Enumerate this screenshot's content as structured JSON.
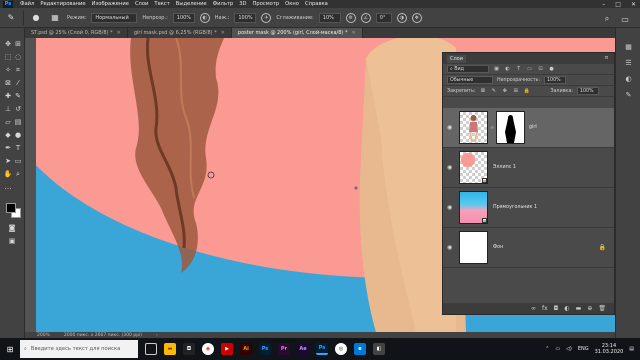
{
  "menubar": {
    "items": [
      "Файл",
      "Редактирование",
      "Изображение",
      "Слои",
      "Текст",
      "Выделение",
      "Фильтр",
      "3D",
      "Просмотр",
      "Окно",
      "Справка"
    ]
  },
  "options": {
    "mode_label": "Режим:",
    "mode_value": "Нормальный",
    "opacity_label": "Непрозр.:",
    "opacity_value": "100%",
    "pressure_label": "Наж.:",
    "pressure_value": "100%",
    "smoothing_label": "Сглаживание:",
    "smoothing_value": "10%",
    "angle_value": "0°"
  },
  "tabs": [
    {
      "label": "ST.psd @ 25% (Слой 0, RGB/8) *",
      "active": false
    },
    {
      "label": "girl mask.psd @ 6,25% (RGB/8) *",
      "active": false
    },
    {
      "label": "poster mask @ 200% (girl, Слой-маска/8) *",
      "active": true
    }
  ],
  "status": {
    "zoom": "200%",
    "doc_info": "2000 пикс. x 2667 пикс. (300 ppi)"
  },
  "layers_panel": {
    "title": "Слои",
    "filter_value": "Вид",
    "blend_value": "Обычные",
    "opacity_label": "Непрозрачность:",
    "opacity_value": "100%",
    "lock_label": "Закрепить:",
    "fill_label": "Заливка:",
    "fill_value": "100%",
    "layers": [
      {
        "name": "girl",
        "selected": true
      },
      {
        "name": "Эллипс 1",
        "selected": false
      },
      {
        "name": "Прямоугольник 1",
        "selected": false
      },
      {
        "name": "Фон",
        "selected": false
      }
    ]
  },
  "taskbar": {
    "search_placeholder": "Введите здесь текст для поиска",
    "apps": [
      {
        "label": "Ps",
        "color": "#001e36"
      },
      {
        "label": "Ai",
        "color": "#330000"
      },
      {
        "label": "Pr",
        "color": "#2a0a2e"
      },
      {
        "label": "Ae",
        "color": "#1a0a33"
      },
      {
        "label": "Ps",
        "color": "#001e36"
      }
    ],
    "language": "ENG",
    "time": "23:14",
    "date": "31.03.2020"
  },
  "colors": {
    "background_pink": "#fa9a92",
    "background_blue": "#3aa6d8",
    "skin": "#e8b98e",
    "hair": "#9c5a3e"
  }
}
